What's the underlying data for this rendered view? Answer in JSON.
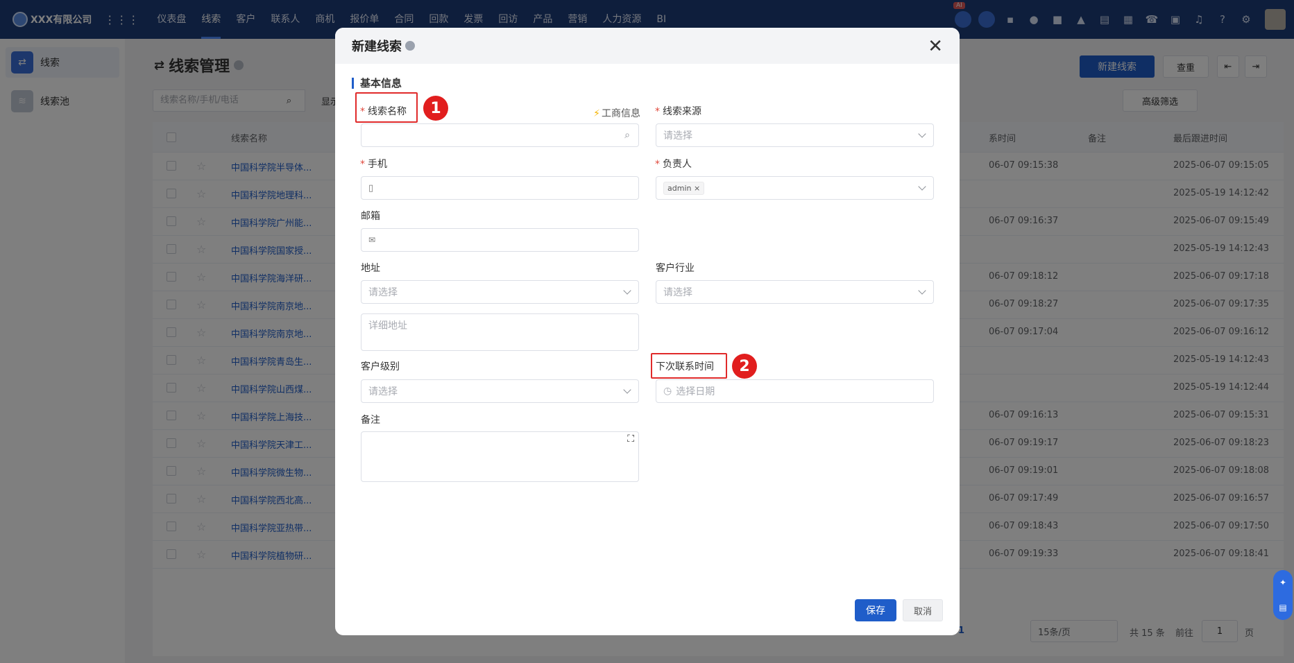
{
  "topbar": {
    "company": "XXX有限公司",
    "menu": [
      "仪表盘",
      "线索",
      "客户",
      "联系人",
      "商机",
      "报价单",
      "合同",
      "回款",
      "发票",
      "回访",
      "产品",
      "营销",
      "人力资源",
      "BI"
    ],
    "active_index": 1,
    "ai_badge": "AI"
  },
  "sidebar": {
    "items": [
      {
        "label": "线索",
        "icon": "leads-icon"
      },
      {
        "label": "线索池",
        "icon": "pool-icon"
      }
    ]
  },
  "page": {
    "title": "线索管理",
    "new_button": "新建线索",
    "dedup_button": "查重",
    "search_placeholder": "线索名称/手机/电话",
    "display_label": "显示",
    "filter_button": "高级筛选"
  },
  "table": {
    "headers": {
      "name": "线索名称",
      "time": "系时间",
      "remark": "备注",
      "last": "最后跟进时间"
    },
    "rows": [
      {
        "name": "中国科学院半导体...",
        "time": "06-07 09:15:38",
        "last": "2025-06-07 09:15:05"
      },
      {
        "name": "中国科学院地理科...",
        "time": "",
        "last": "2025-05-19 14:12:42"
      },
      {
        "name": "中国科学院广州能...",
        "time": "06-07 09:16:37",
        "last": "2025-06-07 09:15:49"
      },
      {
        "name": "中国科学院国家授...",
        "time": "",
        "last": "2025-05-19 14:12:43"
      },
      {
        "name": "中国科学院海洋研...",
        "time": "06-07 09:18:12",
        "last": "2025-06-07 09:17:18"
      },
      {
        "name": "中国科学院南京地...",
        "time": "06-07 09:18:27",
        "last": "2025-06-07 09:17:35"
      },
      {
        "name": "中国科学院南京地...",
        "time": "06-07 09:17:04",
        "last": "2025-06-07 09:16:12"
      },
      {
        "name": "中国科学院青岛生...",
        "time": "",
        "last": "2025-05-19 14:12:43"
      },
      {
        "name": "中国科学院山西煤...",
        "time": "",
        "last": "2025-05-19 14:12:44"
      },
      {
        "name": "中国科学院上海技...",
        "time": "06-07 09:16:13",
        "last": "2025-06-07 09:15:31"
      },
      {
        "name": "中国科学院天津工...",
        "time": "06-07 09:19:17",
        "last": "2025-06-07 09:18:23"
      },
      {
        "name": "中国科学院微生物...",
        "time": "06-07 09:19:01",
        "last": "2025-06-07 09:18:08"
      },
      {
        "name": "中国科学院西北高...",
        "time": "06-07 09:17:49",
        "last": "2025-06-07 09:16:57"
      },
      {
        "name": "中国科学院亚热带...",
        "time": "06-07 09:18:43",
        "last": "2025-06-07 09:17:50"
      },
      {
        "name": "中国科学院植物研...",
        "time": "06-07 09:19:33",
        "last": "2025-06-07 09:18:41"
      }
    ]
  },
  "pagination": {
    "page": "1",
    "page_size": "15条/页",
    "total": "共 15 条",
    "goto": "前往",
    "goto_value": "1",
    "page_unit": "页"
  },
  "modal": {
    "title": "新建线索",
    "section": "基本信息",
    "biz_info": "工商信息",
    "fields": {
      "name": {
        "label": "线索名称"
      },
      "source": {
        "label": "线索来源",
        "placeholder": "请选择"
      },
      "mobile": {
        "label": "手机"
      },
      "owner": {
        "label": "负责人",
        "tag": "admin"
      },
      "email": {
        "label": "邮箱"
      },
      "address": {
        "label": "地址",
        "placeholder": "请选择",
        "detail_placeholder": "详细地址"
      },
      "industry": {
        "label": "客户行业",
        "placeholder": "请选择"
      },
      "level": {
        "label": "客户级别",
        "placeholder": "请选择"
      },
      "next_contact": {
        "label": "下次联系时间",
        "placeholder": "选择日期"
      },
      "remark": {
        "label": "备注"
      }
    },
    "save": "保存",
    "cancel": "取消",
    "badges": [
      "1",
      "2"
    ]
  }
}
